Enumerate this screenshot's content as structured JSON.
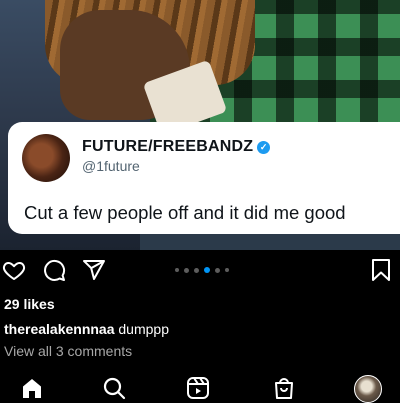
{
  "tweet": {
    "display_name": "FUTURE/FREEBANDZ",
    "handle": "@1future",
    "text": "Cut a few people off and it did me good"
  },
  "post": {
    "likes": "29 likes",
    "caption_user": "therealakennnaa",
    "caption_text": "dumppp",
    "view_comments": "View all 3 comments",
    "carousel": {
      "total": 6,
      "active_index": 3
    }
  },
  "icons": {
    "like": "heart-icon",
    "comment": "comment-icon",
    "share": "send-icon",
    "save": "bookmark-icon",
    "verified": "verified-badge-icon"
  },
  "nav": {
    "items": [
      "home-icon",
      "search-icon",
      "reels-icon",
      "shop-icon",
      "profile-avatar"
    ]
  },
  "colors": {
    "verified": "#1d9bf0",
    "carousel_active": "#0095f6"
  }
}
